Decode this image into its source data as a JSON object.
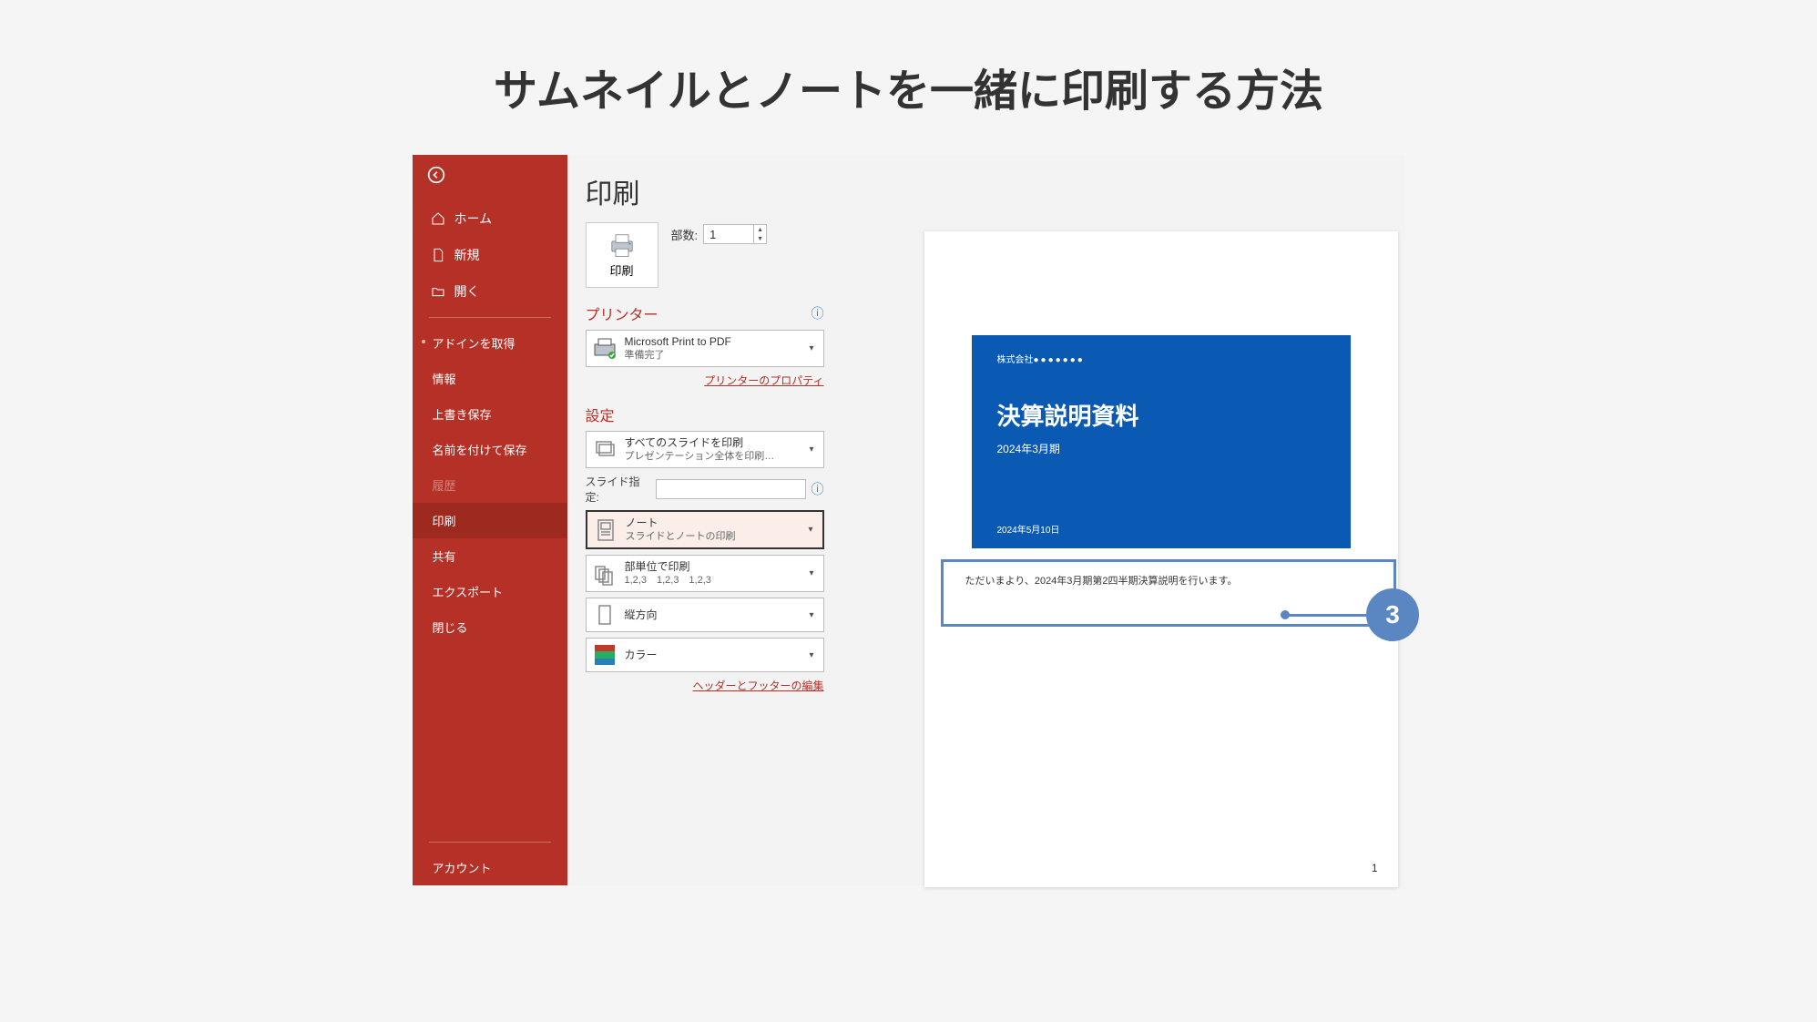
{
  "page_heading": "サムネイルとノートを一緒に印刷する方法",
  "sidebar": {
    "home": "ホーム",
    "new": "新規",
    "open": "開く",
    "addin": "アドインを取得",
    "info": "情報",
    "save": "上書き保存",
    "save_as": "名前を付けて保存",
    "history": "履歴",
    "print": "印刷",
    "share": "共有",
    "export": "エクスポート",
    "close": "閉じる",
    "account": "アカウント"
  },
  "main": {
    "title": "印刷",
    "print_button": "印刷",
    "copies_label": "部数:",
    "copies_value": "1",
    "printer_section": "プリンター",
    "printer_name": "Microsoft Print to PDF",
    "printer_status": "準備完了",
    "printer_properties": "プリンターのプロパティ",
    "settings_section": "設定",
    "setting_all_slides": "すべてのスライドを印刷",
    "setting_all_slides_sub": "プレゼンテーション全体を印刷…",
    "slide_spec_label": "スライド指定:",
    "setting_notes": "ノート",
    "setting_notes_sub": "スライドとノートの印刷",
    "setting_collate": "部単位で印刷",
    "setting_collate_sub": "1,2,3　1,2,3　1,2,3",
    "setting_orientation": "縦方向",
    "setting_color": "カラー",
    "edit_header_footer": "ヘッダーとフッターの編集"
  },
  "preview": {
    "company_label": "株式会社",
    "slide_title": "決算説明資料",
    "slide_subtitle": "2024年3月期",
    "slide_date": "2024年5月10日",
    "note_text": "ただいまより、2024年3月期第2四半期決算説明を行います。",
    "page_number": "1"
  },
  "callout": {
    "number": "3"
  }
}
